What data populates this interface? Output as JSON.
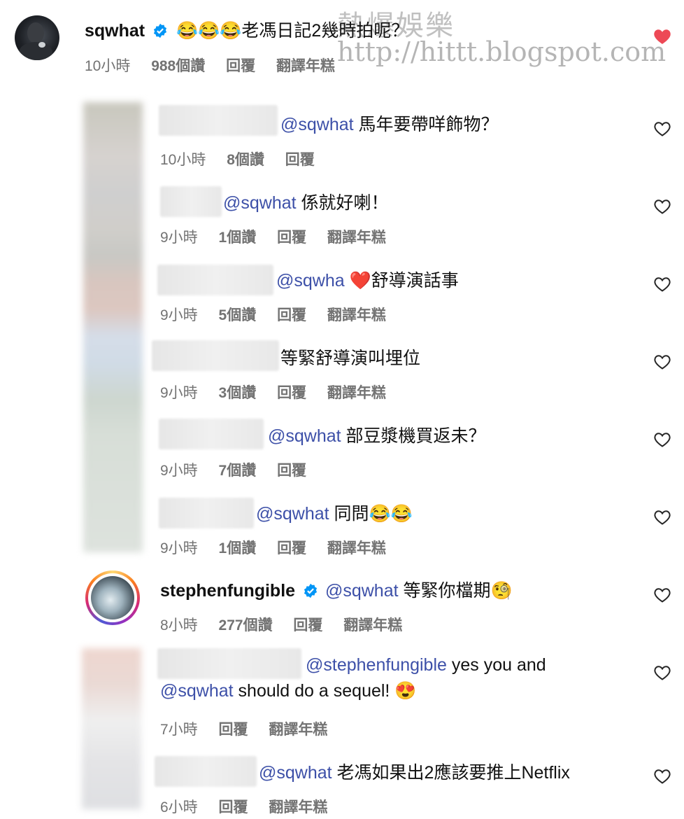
{
  "main_comment": {
    "username": "sqwhat",
    "verified": true,
    "text": "😂😂😂老馮日記2幾時拍呢？",
    "time": "10小時",
    "likes": "988個讚",
    "reply": "回覆",
    "translate": "翻譯年糕",
    "liked": true
  },
  "watermark": {
    "title": "熱爆娛樂",
    "url": "http://hittt.blogspot.com"
  },
  "replies": [
    {
      "mention": "@sqwhat",
      "text": " 馬年要帶咩飾物？",
      "time": "10小時",
      "likes": "8個讚",
      "reply": "回覆",
      "translate": ""
    },
    {
      "mention": "@sqwhat",
      "text": " 係就好喇！",
      "time": "9小時",
      "likes": "1個讚",
      "reply": "回覆",
      "translate": "翻譯年糕"
    },
    {
      "mention": "@sqwha",
      "text": " ❤️舒導演話事",
      "time": "9小時",
      "likes": "5個讚",
      "reply": "回覆",
      "translate": "翻譯年糕"
    },
    {
      "mention": "",
      "text": "等緊舒導演叫埋位",
      "time": "9小時",
      "likes": "3個讚",
      "reply": "回覆",
      "translate": "翻譯年糕"
    },
    {
      "mention": "@sqwhat",
      "text": " 部豆漿機買返未？",
      "time": "9小時",
      "likes": "7個讚",
      "reply": "回覆",
      "translate": ""
    },
    {
      "mention": "@sqwhat",
      "text": " 同問😂😂",
      "time": "9小時",
      "likes": "1個讚",
      "reply": "回覆",
      "translate": "翻譯年糕"
    },
    {
      "username": "stephenfungible",
      "verified": true,
      "mention": "@sqwhat",
      "text": " 等緊你檔期🧐",
      "time": "8小時",
      "likes": "277個讚",
      "reply": "回覆",
      "translate": "翻譯年糕"
    },
    {
      "mention": "@stephenfungible",
      "text": " yes you and",
      "mention2": "@sqwhat",
      "text2": " should do a sequel! 😍",
      "time": "7小時",
      "likes": "",
      "reply": "回覆",
      "translate": "翻譯年糕"
    },
    {
      "mention": "@sqwhat",
      "text": " 老馮如果出2應該要推上Netflix",
      "time": "6小時",
      "likes": "",
      "reply": "回覆",
      "translate": "翻譯年糕"
    }
  ],
  "colors": {
    "mention": "#3d50a8",
    "meta": "#737373",
    "liked_heart": "#ed4956",
    "verified": "#0095f6"
  }
}
